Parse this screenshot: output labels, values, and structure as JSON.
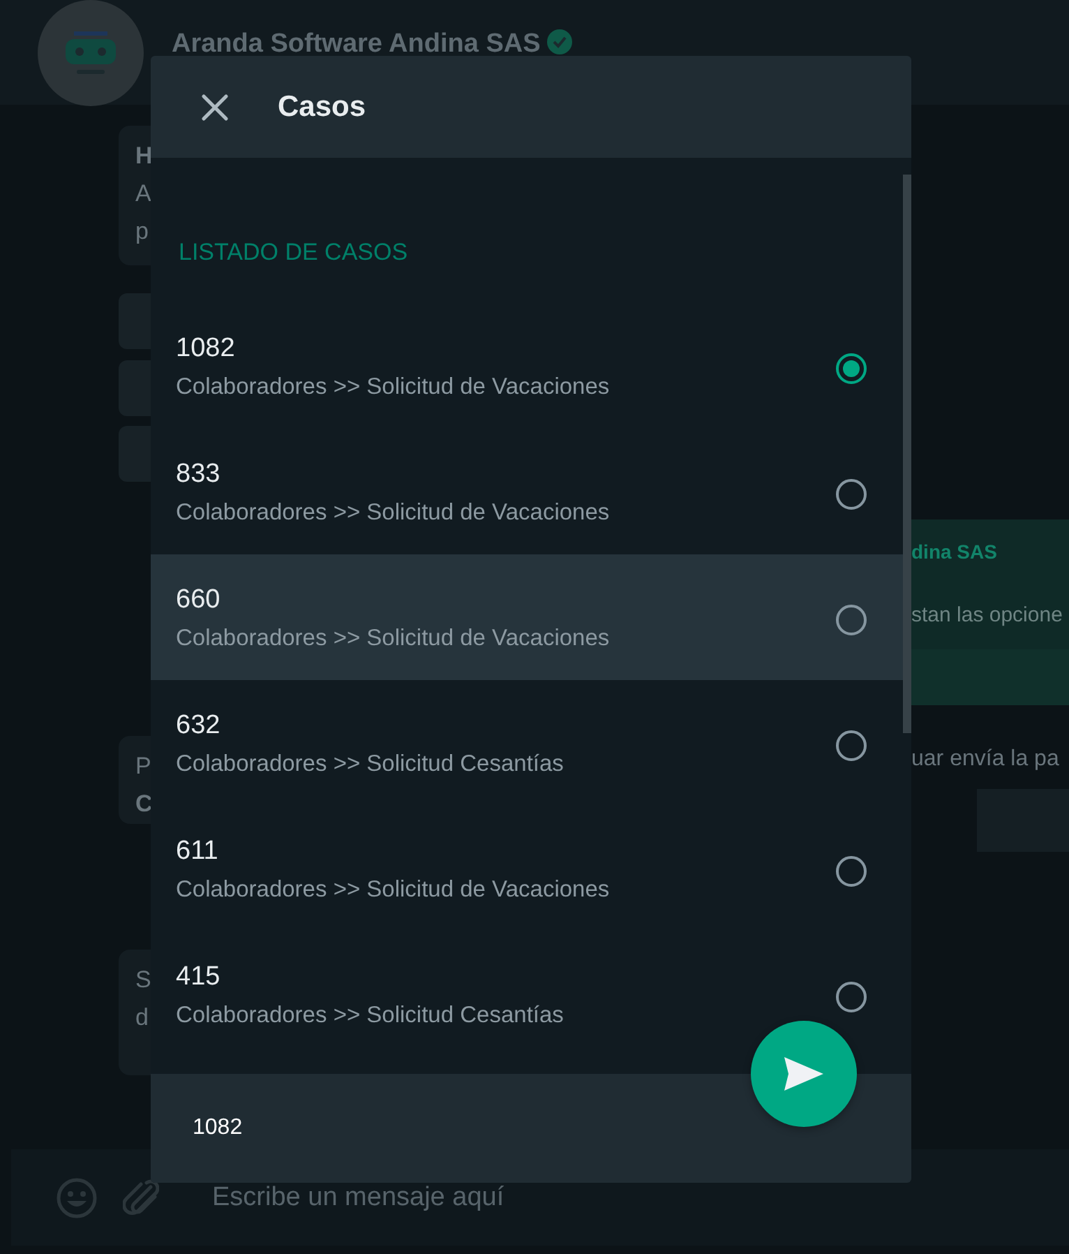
{
  "chat": {
    "contact_name": "Aranda Software Andina SAS",
    "verified": true,
    "rows": [
      {
        "left": {
          "kind": "bubble",
          "lines": [
            {
              "text": "H",
              "bold": true
            },
            {
              "text": "A",
              "bold": false
            },
            {
              "text": "p",
              "bold": false
            }
          ]
        }
      },
      {
        "left": {
          "kind": "option_block"
        }
      },
      {
        "left": {
          "kind": "option_block"
        }
      },
      {
        "left": {
          "kind": "option_block"
        }
      },
      {
        "right": {
          "kind": "card",
          "lines": [
            {
              "text": "dina SAS",
              "bold": true
            },
            {
              "text": "stan las opcione",
              "bold": false
            }
          ]
        }
      },
      {
        "left": {
          "kind": "bubble",
          "lines": [
            {
              "text": "P",
              "bold": false
            },
            {
              "text": "C",
              "bold": true
            }
          ]
        },
        "right": {
          "kind": "text",
          "lines": [
            {
              "text": "uar envía la pa",
              "bold": false
            }
          ]
        }
      },
      {
        "left": {
          "kind": "bubble",
          "lines": [
            {
              "text": "S",
              "bold": false
            },
            {
              "text": "d",
              "bold": false
            }
          ]
        }
      }
    ],
    "input": {
      "placeholder": "Escribe un mensaje aquí"
    }
  },
  "modal": {
    "title": "Casos",
    "section_title": "LISTADO DE CASOS",
    "cases": [
      {
        "number": "1082",
        "category": "Colaboradores >> Solicitud de Vacaciones",
        "selected": true,
        "hovered": false
      },
      {
        "number": "833",
        "category": "Colaboradores >> Solicitud de Vacaciones",
        "selected": false,
        "hovered": false
      },
      {
        "number": "660",
        "category": "Colaboradores >> Solicitud de Vacaciones",
        "selected": false,
        "hovered": true
      },
      {
        "number": "632",
        "category": "Colaboradores >> Solicitud Cesantías",
        "selected": false,
        "hovered": false
      },
      {
        "number": "611",
        "category": "Colaboradores >> Solicitud de Vacaciones",
        "selected": false,
        "hovered": false
      },
      {
        "number": "415",
        "category": "Colaboradores >> Solicitud Cesantías",
        "selected": false,
        "hovered": false
      }
    ],
    "selection_value": "1082"
  }
}
